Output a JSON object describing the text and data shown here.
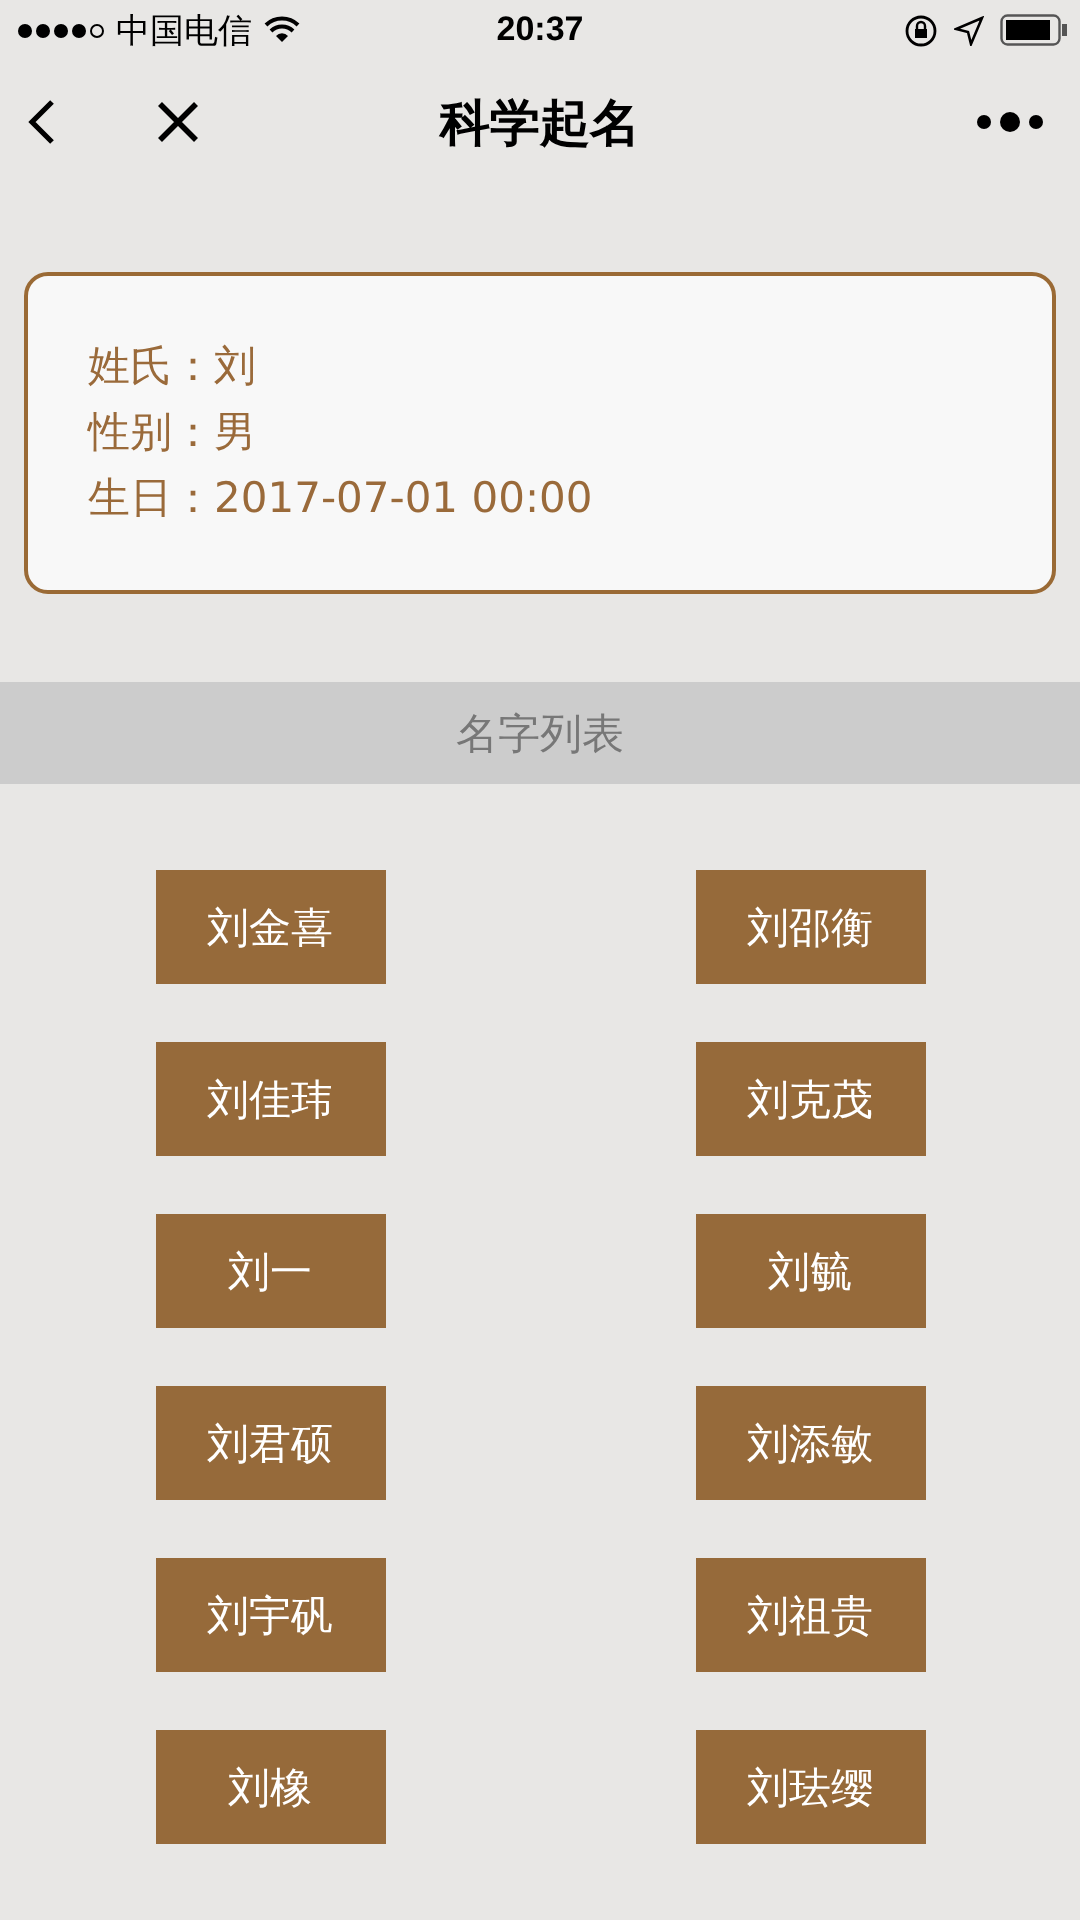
{
  "status_bar": {
    "carrier": "中国电信",
    "time": "20:37"
  },
  "nav": {
    "title": "科学起名"
  },
  "info": [
    {
      "label": "姓氏：",
      "value": "刘"
    },
    {
      "label": "性别：",
      "value": "男"
    },
    {
      "label": "生日：",
      "value": "2017-07-01 00:00"
    }
  ],
  "section_title": "名字列表",
  "names": [
    "刘金喜",
    "刘邵衡",
    "刘佳玮",
    "刘克茂",
    "刘一",
    "刘毓",
    "刘君硕",
    "刘添敏",
    "刘宇矾",
    "刘祖贵",
    "刘橡",
    "刘珐缨"
  ]
}
